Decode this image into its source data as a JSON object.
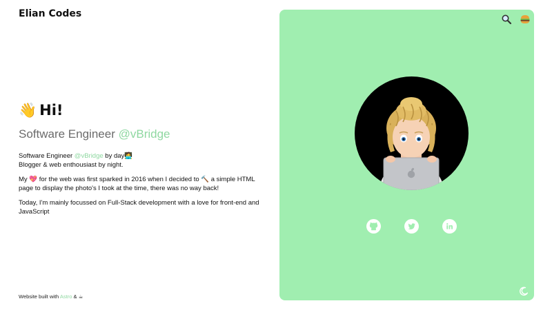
{
  "site": {
    "title": "Elian Codes"
  },
  "hero": {
    "wave_emoji": "👋",
    "greeting": "Hi!",
    "subtitle_prefix": "Software Engineer ",
    "subtitle_handle": "@vBridge"
  },
  "bio": {
    "line1_prefix": "Software Engineer ",
    "line1_handle": "@vBridge",
    "line1_suffix": " by day🧑‍💻",
    "line2": "Blogger & web enthousiast by night.",
    "p2_start": "My ",
    "heart_emoji": "💖",
    "p2_mid": " for the web was first sparked in 2016 when I decided to ",
    "hammer_emoji": "🔨",
    "p2_end": " a simple HTML page to display the photo's I took at the time, there was no way back!",
    "p3": "Today, I'm mainly focussed on Full-Stack development with a love for front-end and JavaScript"
  },
  "footer": {
    "prefix": "Website built with ",
    "link": "Astro",
    "suffix": " & ☕"
  },
  "panel": {
    "icons": {
      "search": "search-icon",
      "menu": "hamburger-icon",
      "theme": "moon-icon",
      "github": "github-icon",
      "twitter": "twitter-icon",
      "linkedin": "linkedin-icon"
    }
  },
  "colors": {
    "accent": "#8fd8a1",
    "panel_bg": "#a0eeb0",
    "avatar_bg": "#000000"
  }
}
